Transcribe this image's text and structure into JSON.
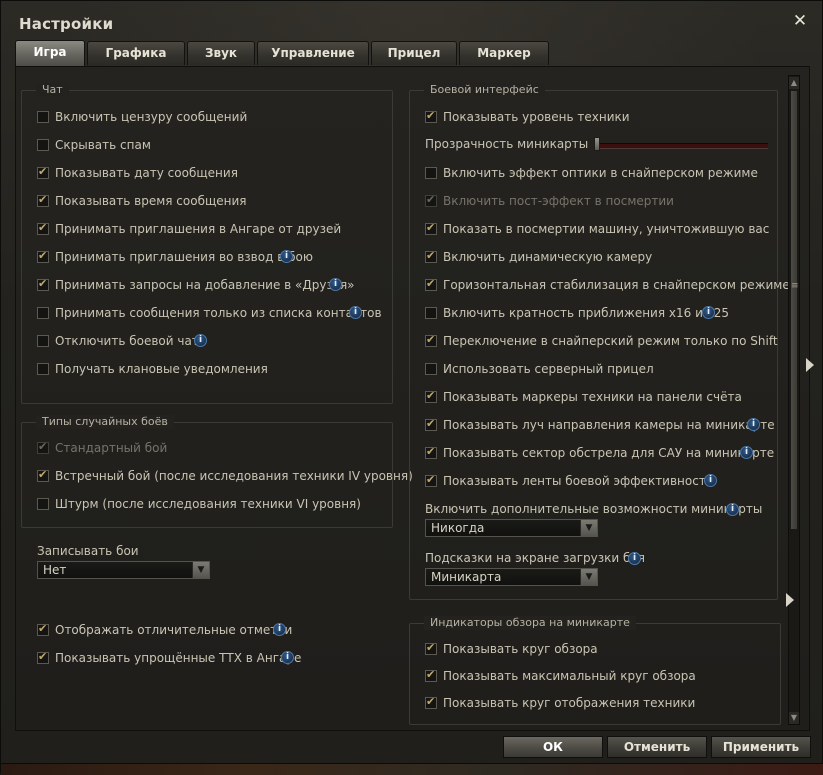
{
  "window": {
    "title": "Настройки",
    "close_glyph": "✕"
  },
  "tabs": [
    {
      "label": "Игра",
      "active": true
    },
    {
      "label": "Графика",
      "active": false
    },
    {
      "label": "Звук",
      "active": false
    },
    {
      "label": "Управление",
      "active": false
    },
    {
      "label": "Прицел",
      "active": false
    },
    {
      "label": "Маркер",
      "active": false
    }
  ],
  "chat": {
    "title": "Чат",
    "items": [
      {
        "label": "Включить цензуру сообщений",
        "checked": false,
        "info": false
      },
      {
        "label": "Скрывать спам",
        "checked": false,
        "info": false
      },
      {
        "label": "Показывать дату сообщения",
        "checked": true,
        "info": false
      },
      {
        "label": "Показывать время сообщения",
        "checked": true,
        "info": false
      },
      {
        "label": "Принимать приглашения в Ангаре от друзей",
        "checked": true,
        "info": false
      },
      {
        "label": "Принимать приглашения во взвод в бою",
        "checked": true,
        "info": true
      },
      {
        "label": "Принимать запросы на добавление в «Друзья»",
        "checked": true,
        "info": true
      },
      {
        "label": "Принимать сообщения только из списка контактов",
        "checked": false,
        "info": true
      },
      {
        "label": "Отключить боевой чат",
        "checked": false,
        "info": true
      },
      {
        "label": "Получать клановые уведомления",
        "checked": false,
        "info": false
      }
    ]
  },
  "battle_types": {
    "title": "Типы случайных боёв",
    "items": [
      {
        "label": "Стандартный бой",
        "checked": true,
        "disabled": true
      },
      {
        "label": "Встречный бой (после исследования техники IV уровня)",
        "checked": true,
        "disabled": false
      },
      {
        "label": "Штурм (после исследования техники VI уровня)",
        "checked": false,
        "disabled": false
      }
    ]
  },
  "replays": {
    "label": "Записывать бои",
    "value": "Нет"
  },
  "extra": [
    {
      "label": "Отображать отличительные отметки",
      "checked": true
    },
    {
      "label": "Показывать упрощённые ТТХ в Ангаре",
      "checked": true
    }
  ],
  "battle_ui": {
    "title": "Боевой интерфейс",
    "show_tier": {
      "label": "Показывать уровень техники",
      "checked": true
    },
    "minimap_alpha_label": "Прозрачность миникарты",
    "minimap_alpha_level": 0.0,
    "items": [
      {
        "label": "Включить эффект оптики в снайперском режиме",
        "checked": false,
        "disabled": false,
        "info": false
      },
      {
        "label": "Включить пост-эффект в посмертии",
        "checked": true,
        "disabled": true,
        "info": false
      },
      {
        "label": "Показать в посмертии машину, уничтожившую вас",
        "checked": true,
        "disabled": false,
        "info": false
      },
      {
        "label": "Включить динамическую камеру",
        "checked": true,
        "disabled": false,
        "info": false
      },
      {
        "label": "Горизонтальная стабилизация в снайперском режиме",
        "checked": true,
        "disabled": false,
        "info": false
      },
      {
        "label": "Включить кратность приближения x16 и x25",
        "checked": false,
        "disabled": false,
        "info": true
      },
      {
        "label": "Переключение в снайперский режим только по Shift",
        "checked": true,
        "disabled": false,
        "info": false
      },
      {
        "label": "Использовать серверный прицел",
        "checked": false,
        "disabled": false,
        "info": false
      },
      {
        "label": "Показывать маркеры техники на панели счёта",
        "checked": true,
        "disabled": false,
        "info": false
      },
      {
        "label": "Показывать луч направления камеры на миникарте",
        "checked": true,
        "disabled": false,
        "info": true
      },
      {
        "label": "Показывать сектор обстрела для САУ на миникарте",
        "checked": true,
        "disabled": false,
        "info": true
      },
      {
        "label": "Показывать ленты боевой эффективности",
        "checked": true,
        "disabled": false,
        "info": true
      }
    ],
    "minimap_extra": {
      "label": "Включить дополнительные возможности миникарты",
      "value": "Никогда"
    },
    "loading_hints": {
      "label": "Подсказки на экране загрузки боя",
      "value": "Миникарта"
    }
  },
  "minimap_indicators": {
    "title": "Индикаторы обзора на миникарте",
    "items": [
      {
        "label": "Показывать круг обзора",
        "checked": true
      },
      {
        "label": "Показывать максимальный круг обзора",
        "checked": true
      },
      {
        "label": "Показывать круг отображения техники",
        "checked": true
      }
    ]
  },
  "buttons": {
    "ok": "ОК",
    "cancel": "Отменить",
    "apply": "Применить"
  },
  "icons": {
    "info": "i",
    "dropdown_arrow": "▼",
    "scroll_up": "▲",
    "scroll_down": "▼",
    "scroll_grip": "≡"
  },
  "colors": {
    "accent_check": "#c2a96d",
    "info_blue": "#2f5a8a",
    "slider_track": "#3c0f0e"
  }
}
